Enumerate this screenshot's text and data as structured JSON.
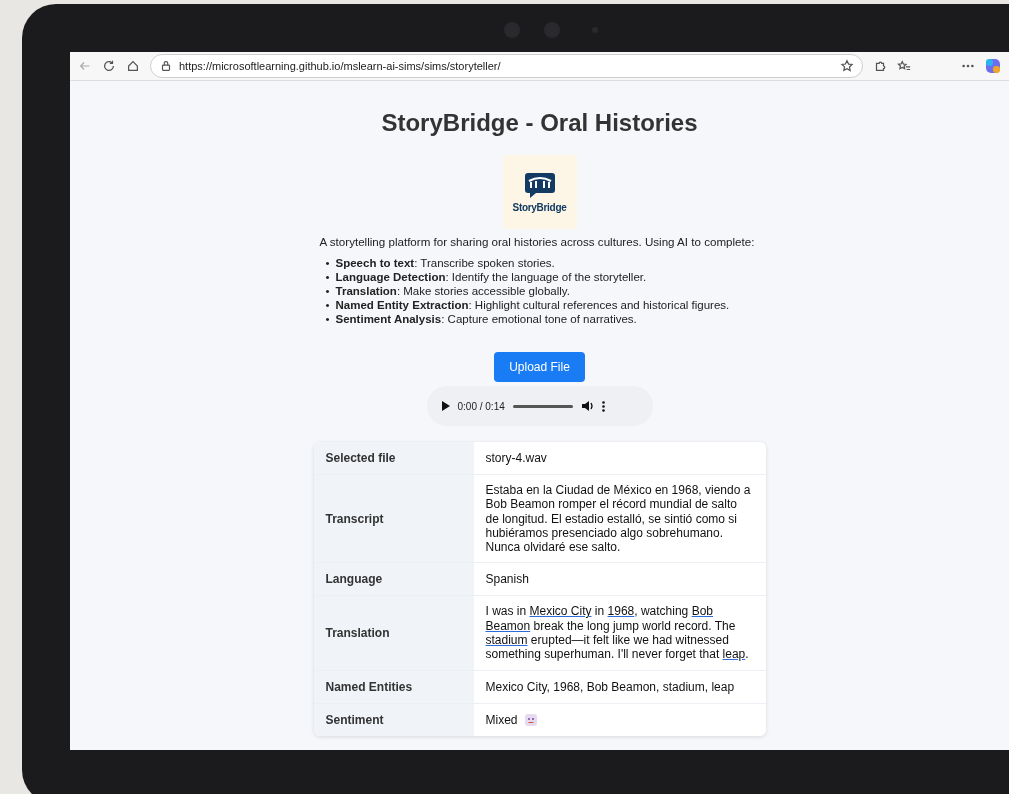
{
  "browser": {
    "url": "https://microsoftlearning.github.io/mslearn-ai-sims/sims/storyteller/"
  },
  "page": {
    "title": "StoryBridge - Oral Histories",
    "logo_text": "StoryBridge",
    "intro": "A storytelling platform for sharing oral histories across cultures. Using AI to complete:",
    "features": [
      {
        "bullet": "•",
        "name": "Speech to text",
        "text": ": Transcribe spoken stories."
      },
      {
        "bullet": "•",
        "name": "Language Detection",
        "text": ": Identify the language of the storyteller."
      },
      {
        "bullet": "•",
        "name": "Translation",
        "text": ": Make stories accessible globally."
      },
      {
        "bullet": "•",
        "name": "Named Entity Extraction",
        "text": ": Highlight cultural references and historical figures."
      },
      {
        "bullet": "•",
        "name": "Sentiment Analysis",
        "text": ": Capture emotional tone of narratives."
      }
    ],
    "upload_button": "Upload File",
    "audio": {
      "time": "0:00 / 0:14"
    },
    "results": [
      {
        "label": "Selected file",
        "kind": "text",
        "value": "story-4.wav"
      },
      {
        "label": "Transcript",
        "kind": "text",
        "value": "Estaba en la Ciudad de México en 1968, viendo a Bob Beamon romper el récord mundial de salto de longitud. El estadio estalló, se sintió como si hubiéramos presenciado algo sobrehumano. Nunca olvidaré ese salto."
      },
      {
        "label": "Language",
        "kind": "text",
        "value": "Spanish"
      },
      {
        "label": "Translation",
        "kind": "segments",
        "segments": [
          {
            "text": "I was in ",
            "entity": false
          },
          {
            "text": "Mexico City",
            "entity": true
          },
          {
            "text": " in ",
            "entity": false
          },
          {
            "text": "1968",
            "entity": true
          },
          {
            "text": ", watching ",
            "entity": false
          },
          {
            "text": "Bob Beamon",
            "entity": true
          },
          {
            "text": " break the long jump world record. The ",
            "entity": false
          },
          {
            "text": "stadium",
            "entity": true
          },
          {
            "text": " erupted—it felt like we had witnessed something superhuman. I'll never forget that ",
            "entity": false
          },
          {
            "text": "leap",
            "entity": true
          },
          {
            "text": ".",
            "entity": false
          }
        ]
      },
      {
        "label": "Named Entities",
        "kind": "text",
        "value": "Mexico City, 1968, Bob Beamon, stadium, leap"
      },
      {
        "label": "Sentiment",
        "kind": "emoji",
        "value": "Mixed"
      }
    ]
  }
}
